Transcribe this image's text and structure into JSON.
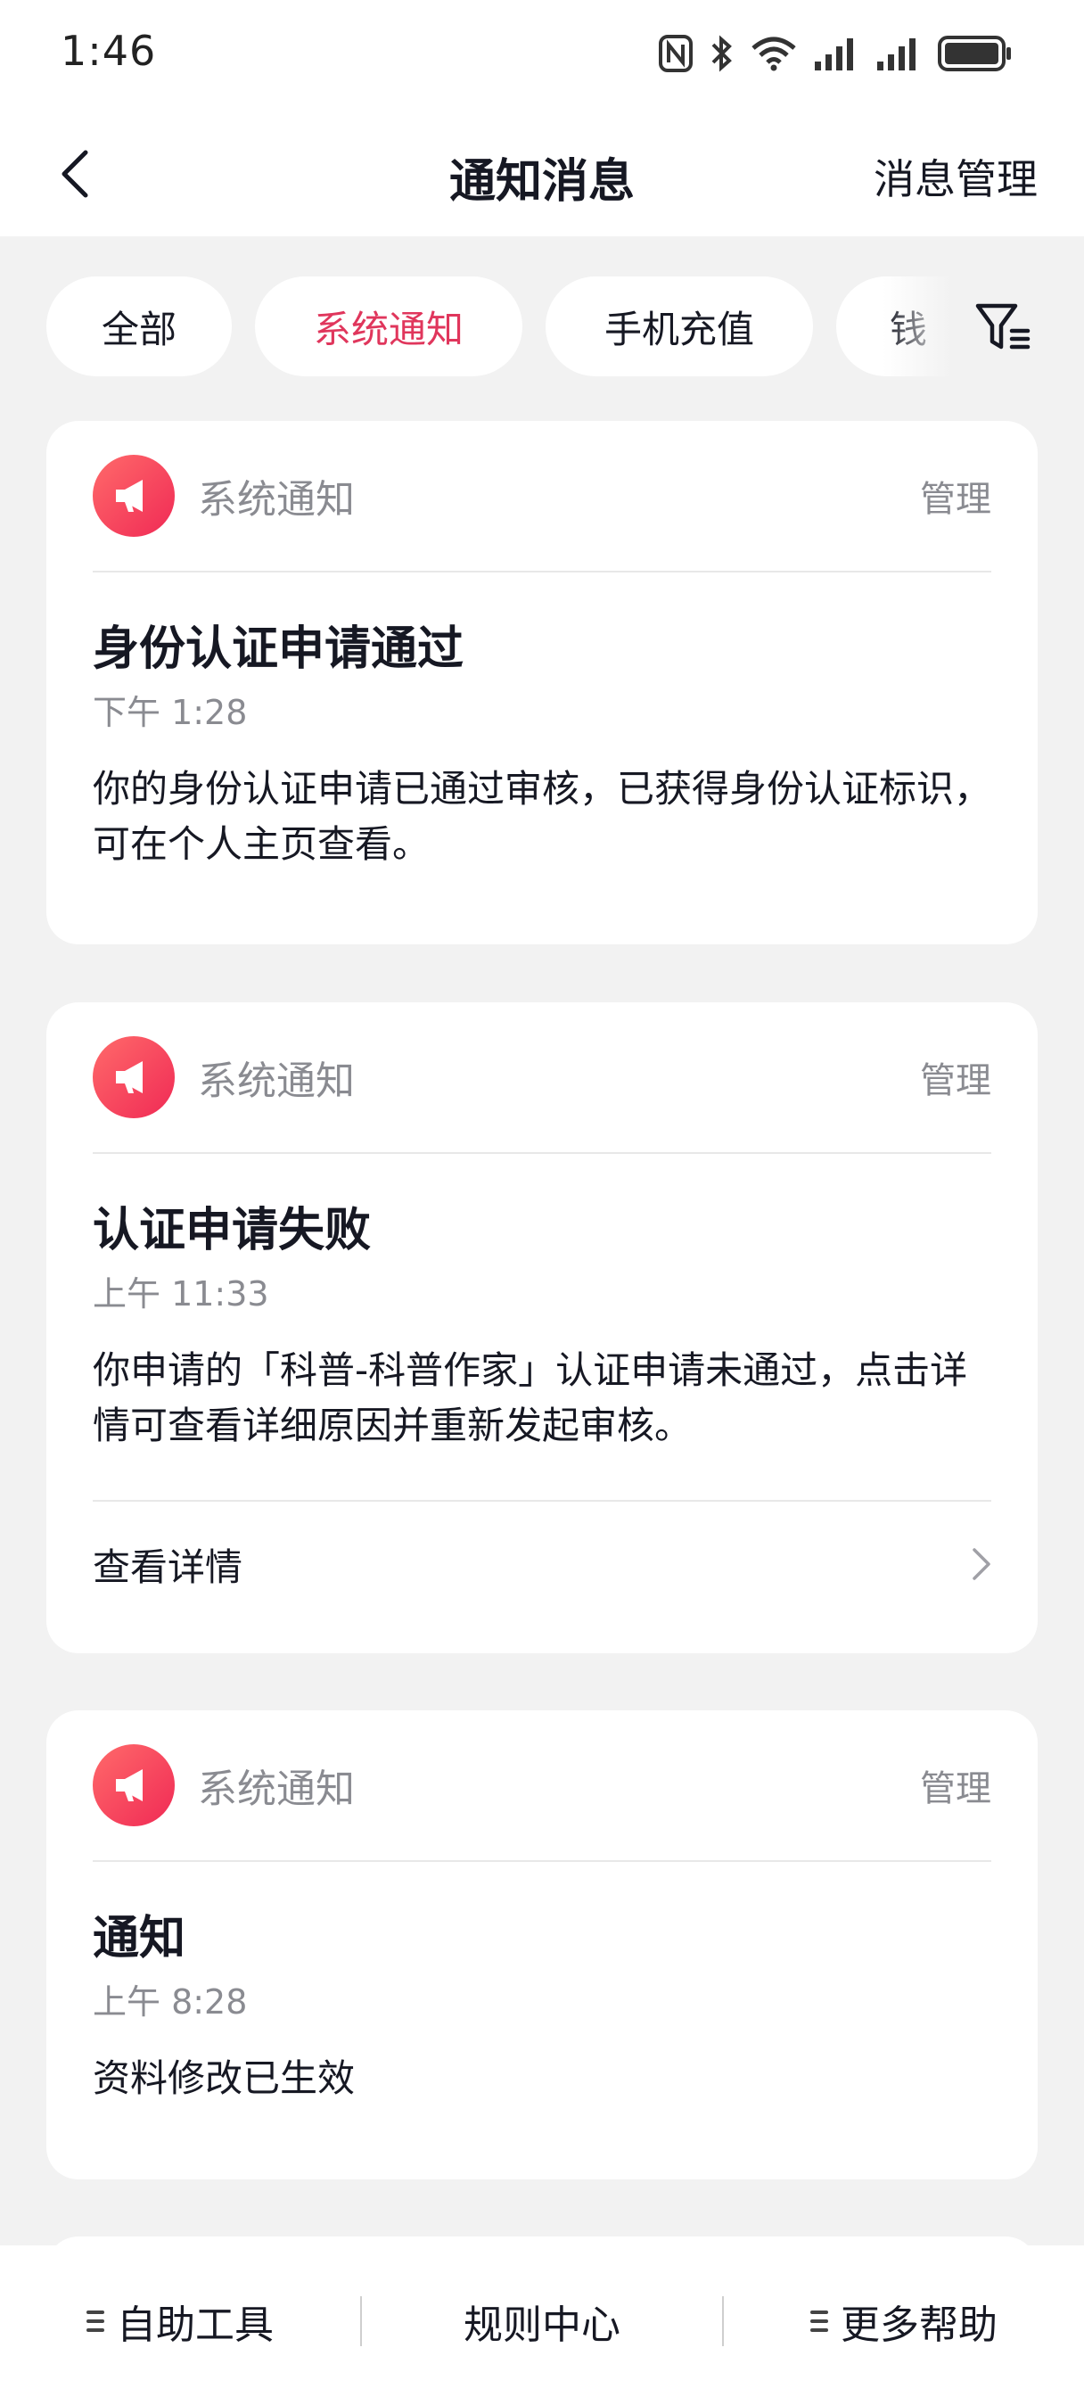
{
  "status_bar": {
    "time": "1:46"
  },
  "nav": {
    "title": "通知消息",
    "right_action": "消息管理"
  },
  "tabs": [
    {
      "label": "全部",
      "active": false
    },
    {
      "label": "系统通知",
      "active": true
    },
    {
      "label": "手机充值",
      "active": false
    },
    {
      "label": "钱",
      "active": false
    }
  ],
  "cards": [
    {
      "source": "系统通知",
      "manage": "管理",
      "title": "身份认证申请通过",
      "time": "下午 1:28",
      "body": "你的身份认证申请已通过审核，已获得身份认证标识，可在个人主页查看。"
    },
    {
      "source": "系统通知",
      "manage": "管理",
      "title": "认证申请失败",
      "time": "上午 11:33",
      "body": "你申请的「科普-科普作家」认证申请未通过，点击详情可查看详细原因并重新发起审核。",
      "detail_label": "查看详情"
    },
    {
      "source": "系统通知",
      "manage": "管理",
      "title": "通知",
      "time": "上午 8:28",
      "body": "资料修改已生效"
    }
  ],
  "bottom_bar": {
    "self_service": "自助工具",
    "rules_center": "规则中心",
    "more_help": "更多帮助"
  },
  "colors": {
    "accent": "#e0365c",
    "background": "#f2f2f2",
    "muted_text": "#8a8b91"
  }
}
